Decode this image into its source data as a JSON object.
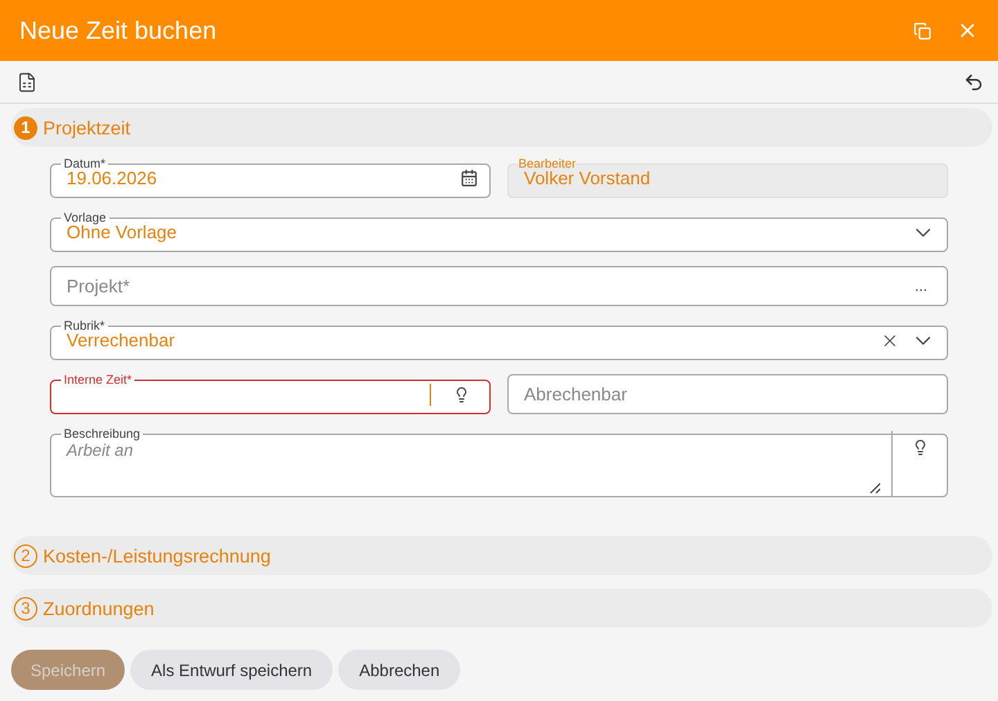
{
  "window": {
    "title": "Neue Zeit buchen"
  },
  "sections": [
    {
      "number": "1",
      "title": "Projektzeit",
      "expanded": true
    },
    {
      "number": "2",
      "title": "Kosten-/Leistungsrechnung",
      "expanded": false
    },
    {
      "number": "3",
      "title": "Zuordnungen",
      "expanded": false
    }
  ],
  "form_rows": [
    [
      {
        "kind": "date",
        "label": "Datum*",
        "value": "19.06.2026"
      },
      {
        "kind": "readonly",
        "label": "Bearbeiter",
        "value": "Volker Vorstand"
      }
    ],
    [
      {
        "kind": "select",
        "label": "Vorlage",
        "value": "Ohne Vorlage",
        "clearable": false
      }
    ],
    [
      {
        "kind": "lookup",
        "placeholder": "Projekt*",
        "button": "..."
      }
    ],
    [
      {
        "kind": "select",
        "label": "Rubrik*",
        "value": "Verrechenbar",
        "clearable": true
      }
    ],
    [
      {
        "kind": "hint",
        "label": "Interne Zeit*",
        "error": true,
        "focused": true
      },
      {
        "kind": "text",
        "placeholder": "Abrechenbar"
      }
    ],
    [
      {
        "kind": "textarea",
        "label": "Beschreibung",
        "placeholder": "Arbeit an"
      }
    ]
  ],
  "buttons": [
    {
      "label": "Speichern",
      "kind": "primary",
      "disabled": true
    },
    {
      "label": "Als Entwurf speichern",
      "kind": "secondary",
      "disabled": false
    },
    {
      "label": "Abbrechen",
      "kind": "secondary",
      "disabled": false
    }
  ]
}
